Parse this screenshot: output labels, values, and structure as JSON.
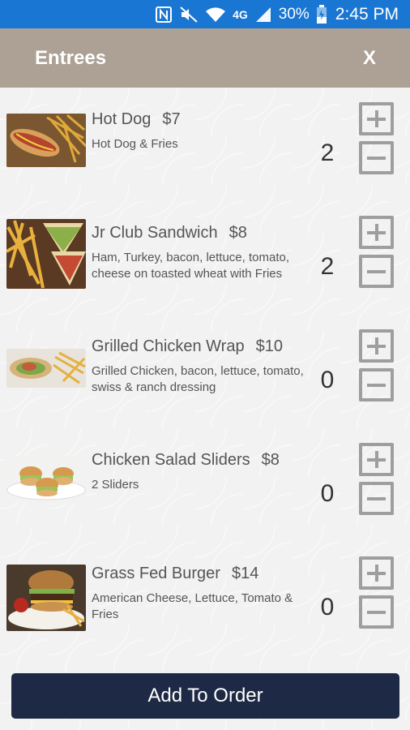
{
  "status_bar": {
    "network": "4G",
    "battery": "30%",
    "time": "2:45 PM",
    "icons": [
      "nfc-icon",
      "mute-icon",
      "wifi-icon",
      "signal-icon",
      "battery-icon"
    ]
  },
  "header": {
    "title": "Entrees",
    "close_label": "X",
    "color": "#ada094"
  },
  "items": [
    {
      "name": "Hot Dog",
      "price": "$7",
      "description": "Hot Dog & Fries",
      "quantity": "2",
      "image": "hot-dog-image"
    },
    {
      "name": "Jr Club Sandwich",
      "price": "$8",
      "description": "Ham, Turkey, bacon, lettuce, tomato, cheese on toasted wheat with Fries",
      "quantity": "2",
      "image": "club-sandwich-image"
    },
    {
      "name": "Grilled Chicken Wrap",
      "price": "$10",
      "description": "Grilled Chicken, bacon, lettuce, tomato, swiss & ranch dressing",
      "quantity": "0",
      "image": "chicken-wrap-image"
    },
    {
      "name": "Chicken Salad Sliders",
      "price": "$8",
      "description": "2 Sliders",
      "quantity": "0",
      "image": "sliders-image"
    },
    {
      "name": "Grass Fed Burger",
      "price": "$14",
      "description": "American Cheese, Lettuce, Tomato & Fries",
      "quantity": "0",
      "image": "burger-image"
    }
  ],
  "add_button_label": "Add To Order",
  "colors": {
    "status_bar": "#1976d2",
    "button": "#1e2a45"
  }
}
